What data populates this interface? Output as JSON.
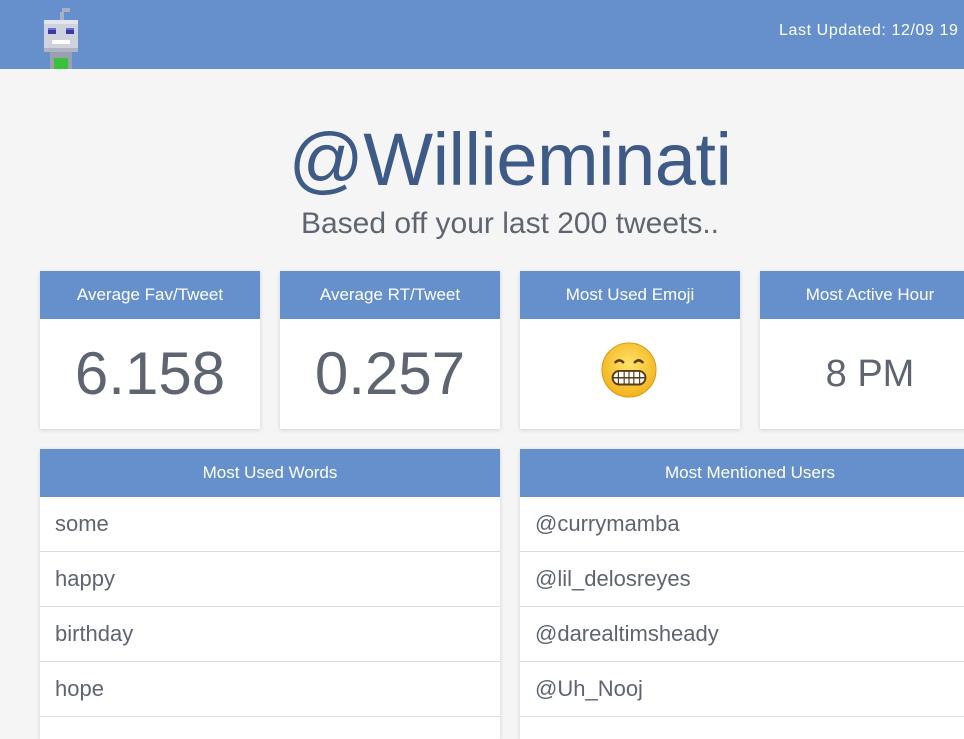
{
  "header": {
    "last_updated": "Last Updated: 12/09 19"
  },
  "profile": {
    "handle": "@Willieminati",
    "subtitle": "Based off your last 200 tweets.."
  },
  "stats": [
    {
      "label": "Average Fav/Tweet",
      "value": "6.158"
    },
    {
      "label": "Average RT/Tweet",
      "value": "0.257"
    },
    {
      "label": "Most Used Emoji",
      "icon": "grimacing-face-emoji"
    },
    {
      "label": "Most Active Hour",
      "value": "8 PM"
    }
  ],
  "words": {
    "title": "Most Used Words",
    "items": [
      "some",
      "happy",
      "birthday",
      "hope"
    ]
  },
  "mentions": {
    "title": "Most Mentioned Users",
    "items": [
      "@currymamba",
      "@lil_delosreyes",
      "@darealtimsheady",
      "@Uh_Nooj"
    ]
  },
  "colors": {
    "accent": "#6690cc",
    "background": "#f5f5f5",
    "handle_text": "#3e5a86",
    "body_text": "#5e6570"
  }
}
